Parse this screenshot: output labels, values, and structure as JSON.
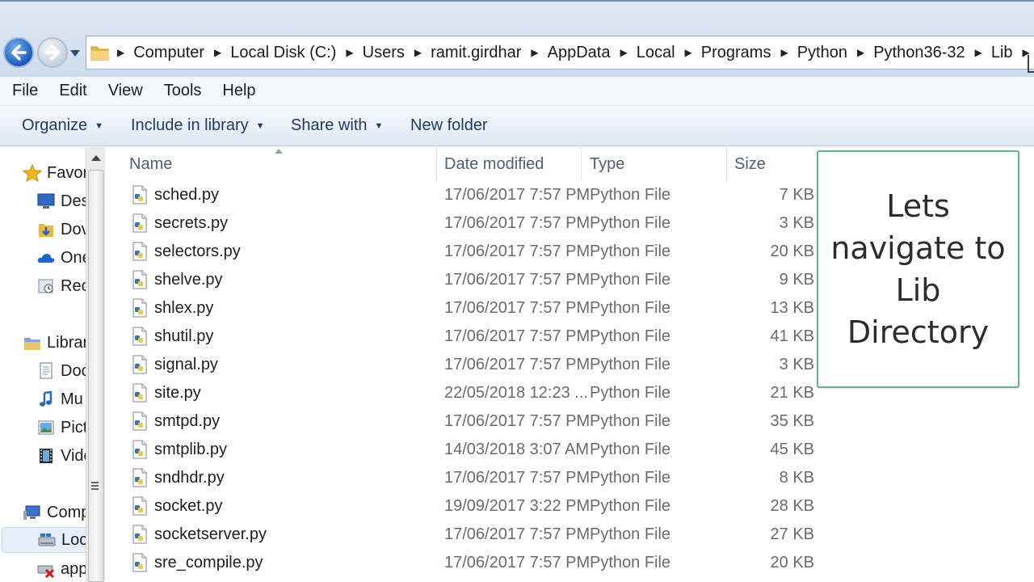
{
  "address_bar": {
    "breadcrumbs": [
      "Computer",
      "Local Disk (C:)",
      "Users",
      "ramit.girdhar",
      "AppData",
      "Local",
      "Programs",
      "Python",
      "Python36-32",
      "Lib"
    ]
  },
  "menu": [
    "File",
    "Edit",
    "View",
    "Tools",
    "Help"
  ],
  "toolbar": {
    "organize": "Organize",
    "include_in_library": "Include in library",
    "share_with": "Share with",
    "new_folder": "New folder"
  },
  "nav_pane": {
    "items": [
      {
        "label": "Favor",
        "icon": "star-icon"
      },
      {
        "label": "Des",
        "icon": "desktop-icon"
      },
      {
        "label": "Dov",
        "icon": "downloads-icon"
      },
      {
        "label": "One",
        "icon": "onedrive-icon"
      },
      {
        "label": "Rec",
        "icon": "recent-places-icon"
      },
      {
        "label": "Librar",
        "icon": "libraries-icon"
      },
      {
        "label": "Doc",
        "icon": "documents-icon"
      },
      {
        "label": "Mu",
        "icon": "music-icon"
      },
      {
        "label": "Pict",
        "icon": "pictures-icon"
      },
      {
        "label": "Vide",
        "icon": "videos-icon"
      },
      {
        "label": "Comp",
        "icon": "computer-icon"
      },
      {
        "label": "Loc",
        "icon": "local-disk-icon"
      },
      {
        "label": "app",
        "icon": "network-drive-disconnected-icon"
      }
    ]
  },
  "columns": {
    "name": "Name",
    "date": "Date modified",
    "type": "Type",
    "size": "Size"
  },
  "files": [
    {
      "name": "sched.py",
      "date": "17/06/2017 7:57 PM",
      "type": "Python File",
      "size": "7 KB"
    },
    {
      "name": "secrets.py",
      "date": "17/06/2017 7:57 PM",
      "type": "Python File",
      "size": "3 KB"
    },
    {
      "name": "selectors.py",
      "date": "17/06/2017 7:57 PM",
      "type": "Python File",
      "size": "20 KB"
    },
    {
      "name": "shelve.py",
      "date": "17/06/2017 7:57 PM",
      "type": "Python File",
      "size": "9 KB"
    },
    {
      "name": "shlex.py",
      "date": "17/06/2017 7:57 PM",
      "type": "Python File",
      "size": "13 KB"
    },
    {
      "name": "shutil.py",
      "date": "17/06/2017 7:57 PM",
      "type": "Python File",
      "size": "41 KB"
    },
    {
      "name": "signal.py",
      "date": "17/06/2017 7:57 PM",
      "type": "Python File",
      "size": "3 KB"
    },
    {
      "name": "site.py",
      "date": "22/05/2018 12:23 ...",
      "type": "Python File",
      "size": "21 KB"
    },
    {
      "name": "smtpd.py",
      "date": "17/06/2017 7:57 PM",
      "type": "Python File",
      "size": "35 KB"
    },
    {
      "name": "smtplib.py",
      "date": "14/03/2018 3:07 AM",
      "type": "Python File",
      "size": "45 KB"
    },
    {
      "name": "sndhdr.py",
      "date": "17/06/2017 7:57 PM",
      "type": "Python File",
      "size": "8 KB"
    },
    {
      "name": "socket.py",
      "date": "19/09/2017 3:22 PM",
      "type": "Python File",
      "size": "28 KB"
    },
    {
      "name": "socketserver.py",
      "date": "17/06/2017 7:57 PM",
      "type": "Python File",
      "size": "27 KB"
    },
    {
      "name": "sre_compile.py",
      "date": "17/06/2017 7:57 PM",
      "type": "Python File",
      "size": "20 KB"
    }
  ],
  "callout": {
    "text": "Lets navigate to Lib Directory"
  },
  "colors": {
    "callout_border": "#5fb39a",
    "toolbar_text": "#1e3a66",
    "column_header_text": "#4c607a"
  }
}
